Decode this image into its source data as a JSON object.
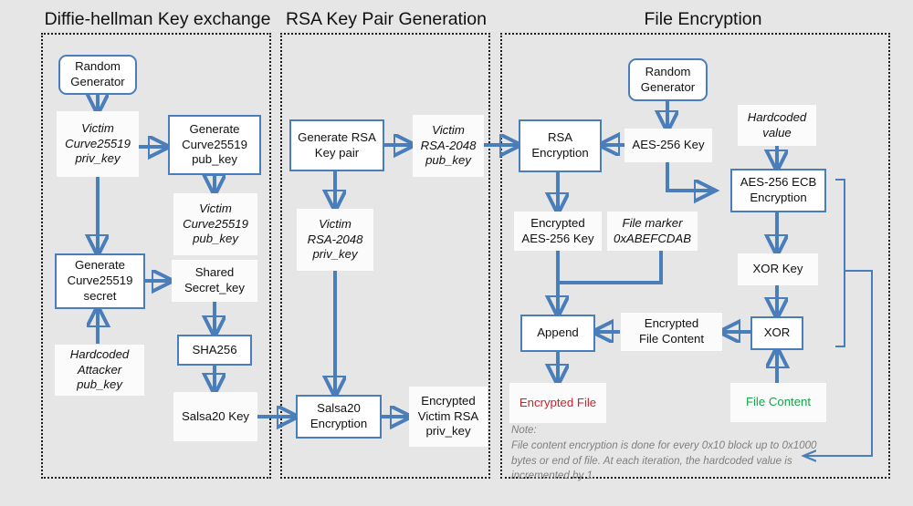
{
  "panels": [
    {
      "title": "Diffie-hellman Key exchange"
    },
    {
      "title": "RSA Key Pair Generation"
    },
    {
      "title": "File Encryption"
    }
  ],
  "dh": {
    "random_generator": "Random\nGenerator",
    "victim_priv": "Victim\nCurve25519\npriv_key",
    "gen_pub": "Generate\nCurve25519\npub_key",
    "victim_pub": "Victim\nCurve25519\npub_key",
    "gen_secret": "Generate\nCurve25519\nsecret",
    "shared_secret": "Shared\nSecret_key",
    "hardcoded_attacker": "Hardcoded\nAttacker\npub_key",
    "sha256": "SHA256",
    "salsa20_key": "Salsa20 Key"
  },
  "rsa": {
    "generate_pair": "Generate RSA\nKey pair",
    "victim_rsa_pub": "Victim\nRSA-2048\npub_key",
    "victim_rsa_priv": "Victim\nRSA-2048\npriv_key",
    "salsa20_encryption": "Salsa20\nEncryption",
    "encrypted_victim_priv": "Encrypted\nVictim RSA\npriv_key"
  },
  "fileenc": {
    "random_generator": "Random\nGenerator",
    "rsa_encryption": "RSA\nEncryption",
    "aes_key": "AES-256 Key",
    "hardcoded_value": "Hardcoded\nvalue",
    "aes_ecb": "AES-256 ECB\nEncryption",
    "encrypted_aes_key": "Encrypted\nAES-256 Key",
    "file_marker": "File marker\n0xABEFCDAB",
    "xor_key": "XOR Key",
    "append": "Append",
    "encrypted_file_content": "Encrypted\nFile Content",
    "xor": "XOR",
    "encrypted_file": "Encrypted File",
    "file_content": "File Content",
    "note": "Note:\nFile content encryption is done for every 0x10 block up to 0x1000\nbytes or end of file. At each iteration, the hardcoded value is\nincremented by 1."
  },
  "colors": {
    "accent_blue": "#4a7ebb",
    "panel_border": "#1a1a1a",
    "background": "#e6e6e6",
    "encrypted_file_red": "#d0202a",
    "file_content_green": "#17a34a",
    "note_gray": "#808080"
  }
}
